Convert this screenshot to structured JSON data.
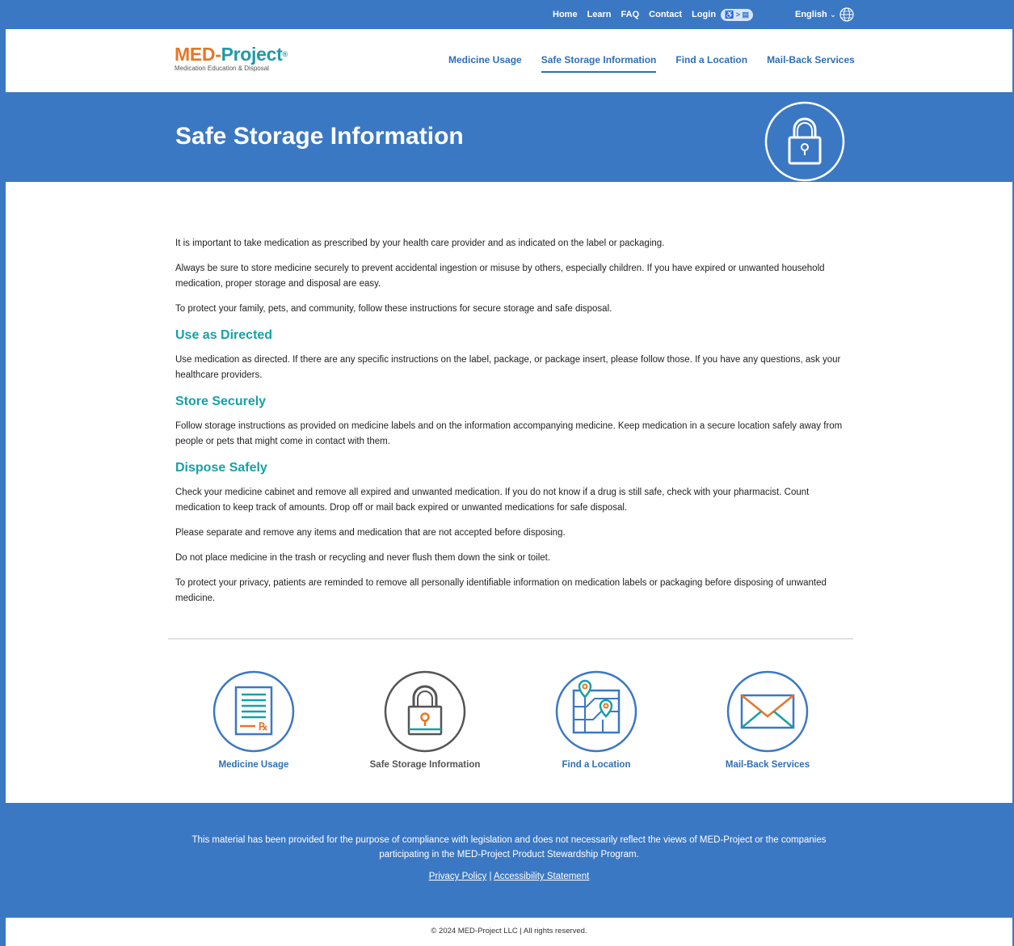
{
  "topbar": {
    "links": [
      "Home",
      "Learn",
      "FAQ",
      "Contact",
      "Login"
    ],
    "a11y_label": "♿ > ▤",
    "language": "English",
    "language_caret": "⌄"
  },
  "logo": {
    "part1": "MED-",
    "part2": "Project",
    "reg": "®",
    "subtitle": "Medication Education & Disposal"
  },
  "nav": {
    "items": [
      "Medicine Usage",
      "Safe Storage Information",
      "Find a Location",
      "Mail-Back Services"
    ],
    "active_index": 1
  },
  "hero": {
    "title": "Safe Storage Information",
    "icon": "lock-icon"
  },
  "content": {
    "intro": [
      "It is important to take medication as prescribed by your health care provider and as indicated on the label or packaging.",
      "Always be sure to store medicine securely to prevent accidental ingestion or misuse by others, especially children. If you have expired or unwanted household medication, proper storage and disposal are easy.",
      "To protect your family, pets, and community, follow these instructions for secure storage and safe disposal."
    ],
    "sections": [
      {
        "heading": "Use as Directed",
        "paragraphs": [
          "Use medication as directed. If there are any specific instructions on the label, package, or package insert, please follow those. If you have any questions, ask your healthcare providers."
        ]
      },
      {
        "heading": "Store Securely",
        "paragraphs": [
          "Follow storage instructions as provided on medicine labels and on the information accompanying medicine. Keep medication in a secure location safely away from people or pets that might come in contact with them."
        ]
      },
      {
        "heading": "Dispose Safely",
        "paragraphs": [
          "Check your medicine cabinet and remove all expired and unwanted medication. If you do not know if a drug is still safe, check with your pharmacist. Count medication to keep track of amounts. Drop off or mail back expired or unwanted medications for safe disposal.",
          "Please separate and remove any items and medication that are not accepted before disposing.",
          "Do not place medicine in the trash or recycling and never flush them down the sink or toilet.",
          "To protect your privacy, patients are reminded to remove all personally identifiable information on medication labels or packaging before disposing of unwanted medicine."
        ]
      }
    ]
  },
  "tiles": [
    {
      "label": "Medicine Usage",
      "icon": "prescription-document-icon"
    },
    {
      "label": "Safe Storage Information",
      "icon": "lock-icon"
    },
    {
      "label": "Find a Location",
      "icon": "map-pin-icon"
    },
    {
      "label": "Mail-Back Services",
      "icon": "envelope-icon"
    }
  ],
  "footer": {
    "disclaimer": "This material has been provided for the purpose of compliance with legislation and does not necessarily reflect the views of MED-Project or the companies participating in the MED-Project Product Stewardship Program.",
    "privacy": "Privacy Policy",
    "separator": "|",
    "accessibility": "Accessibility Statement",
    "copyright": "© 2024 MED-Project LLC | All rights reserved."
  },
  "colors": {
    "brand_blue": "#3b78c4",
    "link_blue": "#2f6fb6",
    "teal": "#17a0a6",
    "orange": "#e57728"
  }
}
